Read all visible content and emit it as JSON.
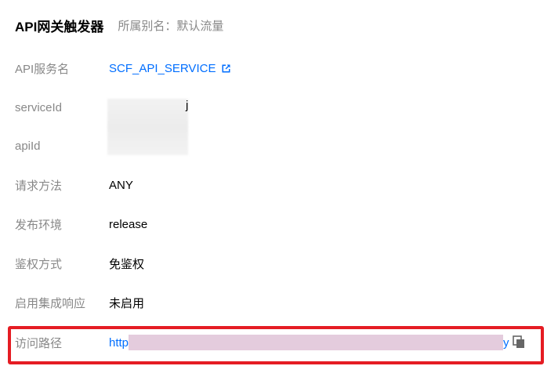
{
  "header": {
    "title": "API网关触发器",
    "alias": "所属别名：默认流量"
  },
  "fields": {
    "service_name": {
      "label": "API服务名",
      "value": "SCF_API_SERVICE"
    },
    "service_id": {
      "label": "serviceId",
      "visible_tail": "j"
    },
    "api_id": {
      "label": "apiId"
    },
    "method": {
      "label": "请求方法",
      "value": "ANY"
    },
    "environment": {
      "label": "发布环境",
      "value": "release"
    },
    "auth": {
      "label": "鉴权方式",
      "value": "免鉴权"
    },
    "integration_response": {
      "label": "启用集成响应",
      "value": "未启用"
    },
    "access_path": {
      "label": "访问路径",
      "value_prefix": "http",
      "value_suffix": "y"
    }
  },
  "colors": {
    "label": "#888888",
    "link": "#006eff",
    "highlight_border": "#e51c23"
  },
  "icons": {
    "external_link": "external-link-icon",
    "copy": "copy-icon"
  }
}
